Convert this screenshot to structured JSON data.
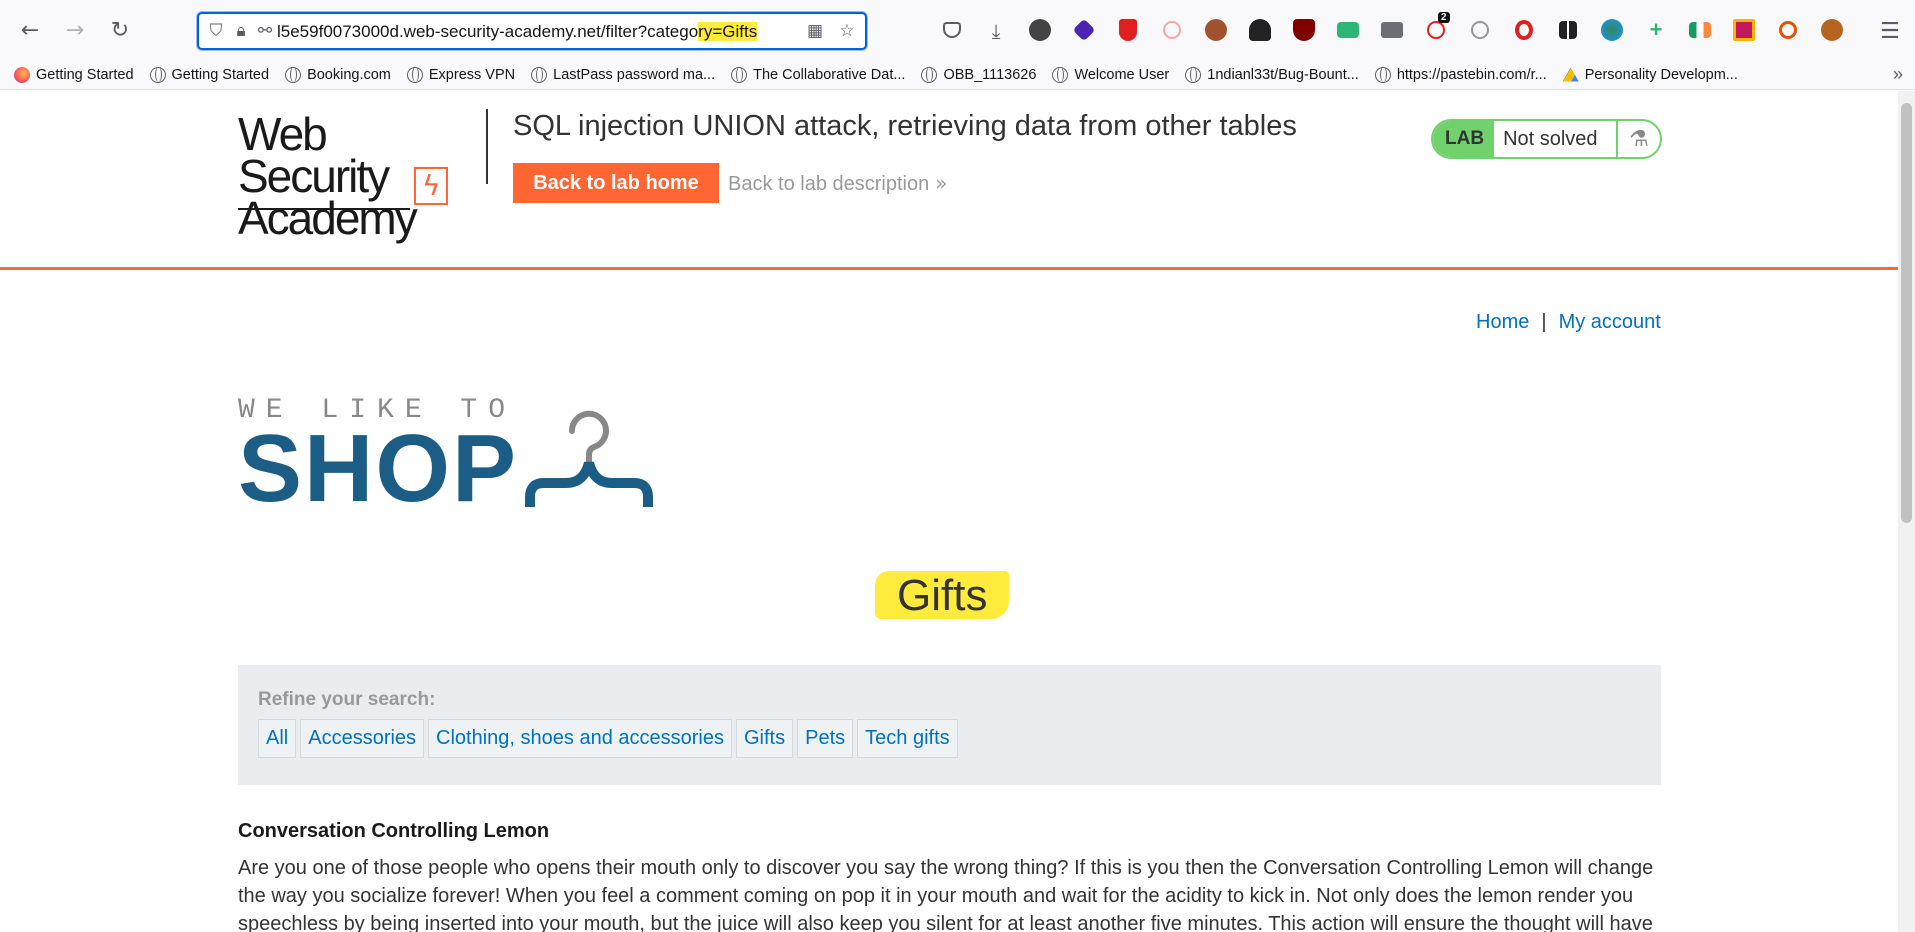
{
  "browser": {
    "url_prefix": "l5e59f0073000d.web-security-academy.net/filter?catego",
    "url_highlight": "ry=Gifts",
    "extension_badge": "2",
    "bookmarks": [
      {
        "label": "Getting Started",
        "icon": "firefox-icon"
      },
      {
        "label": "Getting Started",
        "icon": "globe-icon"
      },
      {
        "label": "Booking.com",
        "icon": "globe-icon"
      },
      {
        "label": "Express VPN",
        "icon": "globe-icon"
      },
      {
        "label": "LastPass password ma...",
        "icon": "globe-icon"
      },
      {
        "label": "The Collaborative Dat...",
        "icon": "globe-icon"
      },
      {
        "label": "OBB_1113626",
        "icon": "globe-icon"
      },
      {
        "label": "Welcome User",
        "icon": "globe-icon"
      },
      {
        "label": "1ndianl33t/Bug-Bount...",
        "icon": "globe-icon"
      },
      {
        "label": "https://pastebin.com/r...",
        "icon": "globe-icon"
      },
      {
        "label": "Personality Developm...",
        "icon": "google-drive-icon"
      }
    ]
  },
  "academy": {
    "logo_line1": "Web Security",
    "logo_line2": "Academy",
    "lab_title": "SQL injection UNION attack, retrieving data from other tables",
    "back_home": "Back to lab home",
    "back_description": "Back to lab description",
    "lab_tag": "LAB",
    "lab_status": "Not solved",
    "accent_color": "#ff6633",
    "solved_color": "#70d16d"
  },
  "nav": {
    "home": "Home",
    "separator": "|",
    "account": "My account"
  },
  "shop": {
    "tagline": "WE LIKE TO",
    "name": "SHOP",
    "brand_color": "#1c5d85"
  },
  "category": {
    "heading": "Gifts",
    "refine_label": "Refine your search:",
    "filters": [
      "All",
      "Accessories",
      "Clothing, shoes and accessories",
      "Gifts",
      "Pets",
      "Tech gifts"
    ]
  },
  "product": {
    "name": "Conversation Controlling Lemon",
    "description": "Are you one of those people who opens their mouth only to discover you say the wrong thing? If this is you then the Conversation Controlling Lemon will change the way you socialize forever! When you feel a comment coming on pop it in your mouth and wait for the acidity to kick in. Not only does the lemon render you speechless by being inserted into your mouth, but the juice will also keep you silent for at least another five minutes. This action will ensure the thought will have"
  }
}
